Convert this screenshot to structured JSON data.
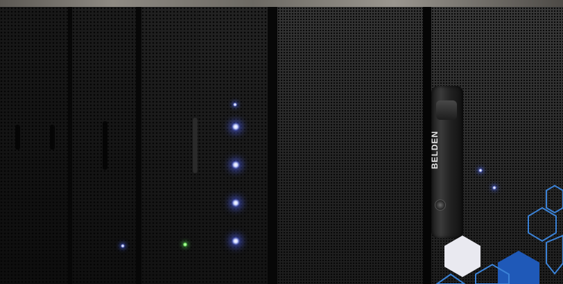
{
  "photo": {
    "subject": "server-rack-row",
    "brand_text": "BELDEN",
    "colors": {
      "led_blue": "#8fa2ff",
      "hex_white": "#e9e9f0",
      "hex_blue": "#1f59b8",
      "hex_outline": "#3b82d6"
    }
  }
}
